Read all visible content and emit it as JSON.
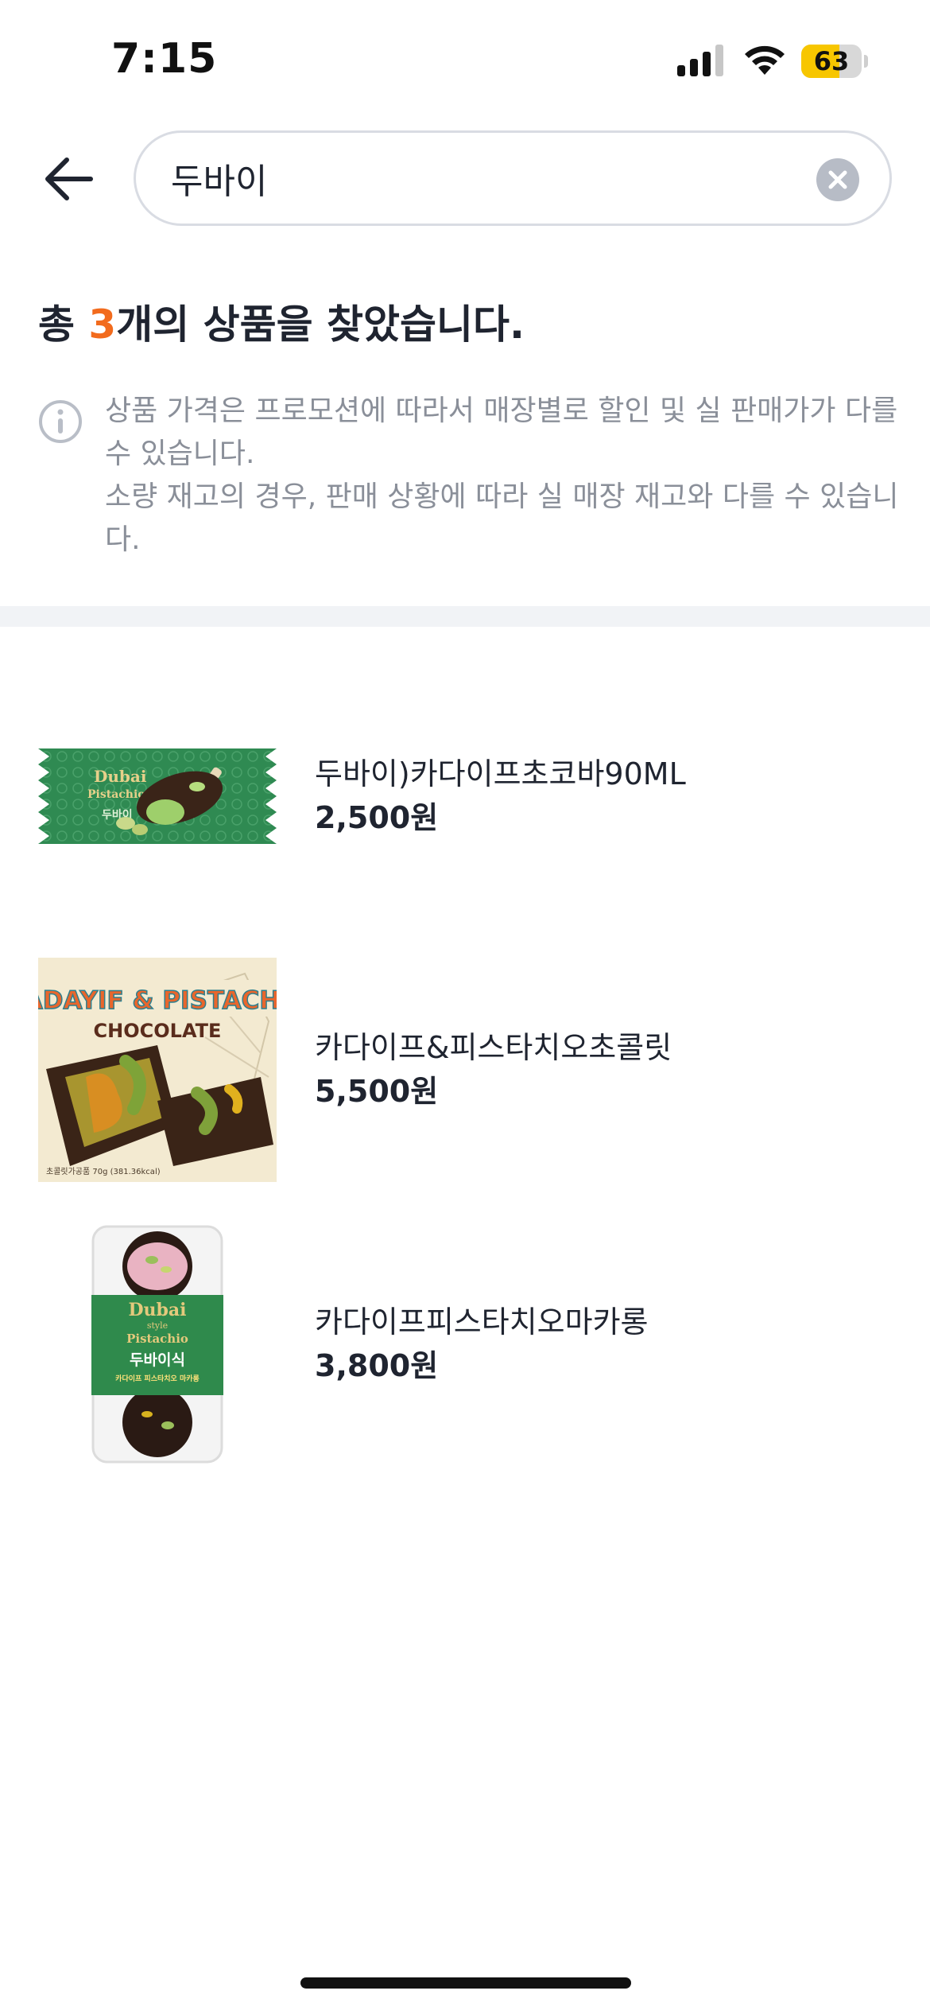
{
  "status_bar": {
    "time": "7:15",
    "battery_level": "63",
    "battery_fraction": 0.63,
    "icons": [
      "signal-icon",
      "wifi-icon",
      "battery-icon"
    ]
  },
  "search": {
    "query": "두바이",
    "back_icon": "arrow-left-icon",
    "clear_icon": "clear-circle-icon"
  },
  "results": {
    "prefix": "총 ",
    "count": "3",
    "suffix": "개의 상품을 찾았습니다."
  },
  "notice": {
    "icon": "info-icon",
    "line1": "상품 가격은 프로모션에 따라서 매장별로 할인 및 실 판매가가 다를 수 있습니다.",
    "line2": "소량 재고의 경우, 판매 상황에 따라 실 매장 재고와 다를 수 있습니다."
  },
  "products": [
    {
      "name": "두바이)카다이프초코바90ML",
      "price": "2,500원",
      "image_text": {
        "brand1": "Dubai",
        "brand2": "Pistachio",
        "label": "두바이"
      }
    },
    {
      "name": "카다이프&피스타치오초콜릿",
      "price": "5,500원",
      "image_text": {
        "banner": "KADAYIF & PISTACHIO",
        "title": "CHOCOLATE",
        "footnote": "초콜릿가공품 70g (381.36kcal)"
      }
    },
    {
      "name": "카다이프피스타치오마카롱",
      "price": "3,800원",
      "image_text": {
        "brand1": "Dubai",
        "brand2": "style",
        "brand3": "Pistachio",
        "label": "두바이식",
        "sublabel": "카다이프 피스타치오 마카롱"
      }
    }
  ],
  "colors": {
    "accent": "#f26b1d",
    "text": "#1f2430",
    "muted": "#8a8f99",
    "divider": "#f1f3f6",
    "battery": "#f7c600"
  }
}
